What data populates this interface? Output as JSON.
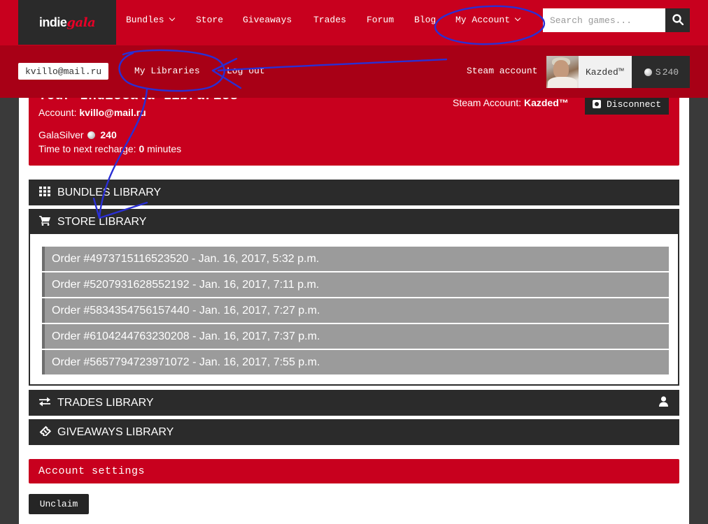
{
  "nav": {
    "logo_indie": "indie",
    "logo_gala": "gala",
    "items": [
      {
        "label": "Bundles"
      },
      {
        "label": "Store"
      },
      {
        "label": "Giveaways"
      },
      {
        "label": "Trades"
      },
      {
        "label": "Forum"
      },
      {
        "label": "Blog"
      },
      {
        "label": "My Account"
      }
    ],
    "search_placeholder": "Search games..."
  },
  "subnav": {
    "email": "kvillo@mail.ru",
    "my_libraries": "My Libraries",
    "logout": "Log out",
    "steam_account": "Steam account",
    "steam_name": "Kazded™",
    "silver_prefix": "S",
    "silver_amount": "240"
  },
  "library": {
    "title": "Your IndieGala Libraries",
    "account_label": "Account: ",
    "account_email": "kvillo@mail.ru",
    "silver_label": "GalaSilver",
    "silver_amount": "240",
    "recharge_label": "Time to next recharge: ",
    "recharge_value": "0",
    "recharge_unit": " minutes",
    "steam_label": "Steam Account: ",
    "steam_name": "Kazded™",
    "disconnect": "Disconnect"
  },
  "sections": {
    "bundles": "BUNDLES LIBRARY",
    "store": "STORE LIBRARY",
    "trades": "TRADES LIBRARY",
    "giveaways": "GIVEAWAYS LIBRARY"
  },
  "orders": [
    "Order #4973715116523520 - Jan. 16, 2017, 5:32 p.m.",
    "Order #5207931628552192 - Jan. 16, 2017, 7:11 p.m.",
    "Order #5834354756157440 - Jan. 16, 2017, 7:27 p.m.",
    "Order #6104244763230208 - Jan. 16, 2017, 7:37 p.m.",
    "Order #5657794723971072 - Jan. 16, 2017, 7:55 p.m."
  ],
  "settings": {
    "title": "Account settings",
    "unclaim": "Unclaim"
  },
  "colors": {
    "brand_red": "#c8001e",
    "dark_red": "#a80016",
    "dark": "#2b2b2b",
    "order_gray": "#9b9b9b",
    "annotation_blue": "#2a2fd4"
  }
}
